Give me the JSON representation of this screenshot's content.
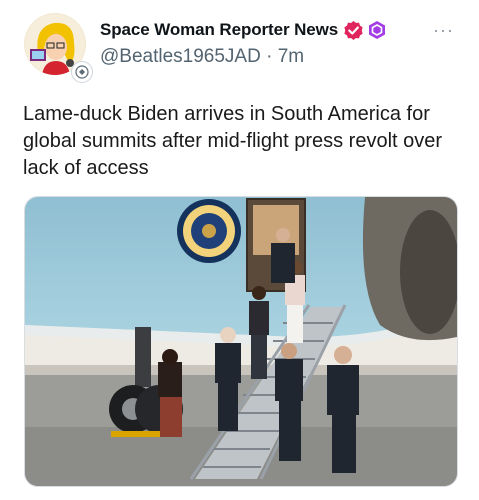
{
  "author": {
    "display_name": "Space Woman Reporter News",
    "handle": "@Beatles1965JAD",
    "separator": "·",
    "time_ago": "7m",
    "verified_color": "#e0245e",
    "hex_badge_color": "#9b3fe0"
  },
  "post": {
    "text": "Lame-duck Biden arrives in South America for global summits after mid-flight press revolt over lack of access"
  },
  "menu": {
    "more_label": "···"
  },
  "media": {
    "icons": [
      "airplane-photo",
      "presidential-seal"
    ]
  }
}
